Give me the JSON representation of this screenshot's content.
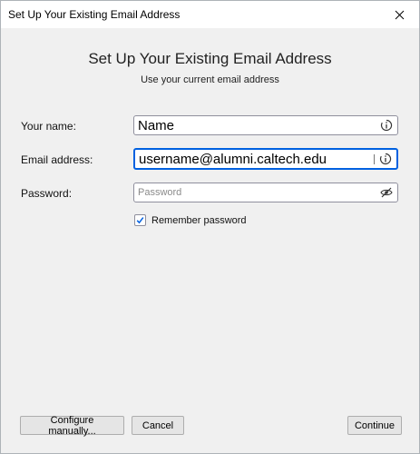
{
  "window": {
    "title": "Set Up Your Existing Email Address"
  },
  "header": {
    "title": "Set Up Your Existing Email Address",
    "subtitle": "Use your current email address"
  },
  "form": {
    "name": {
      "label": "Your name:",
      "value": "Name"
    },
    "email": {
      "label": "Email address:",
      "value": "username@alumni.caltech.edu"
    },
    "password": {
      "label": "Password:",
      "placeholder": "Password",
      "value": ""
    },
    "remember": {
      "label": "Remember password",
      "checked": true
    }
  },
  "buttons": {
    "configure_manually": "Configure manually...",
    "cancel": "Cancel",
    "continue": "Continue"
  },
  "colors": {
    "focus_accent": "#0061e0",
    "check_accent": "#0061e0"
  },
  "icons": {
    "name_field": "info-icon",
    "email_field": "info-icon",
    "password_field": "eye-slash-icon",
    "close": "close-icon"
  }
}
